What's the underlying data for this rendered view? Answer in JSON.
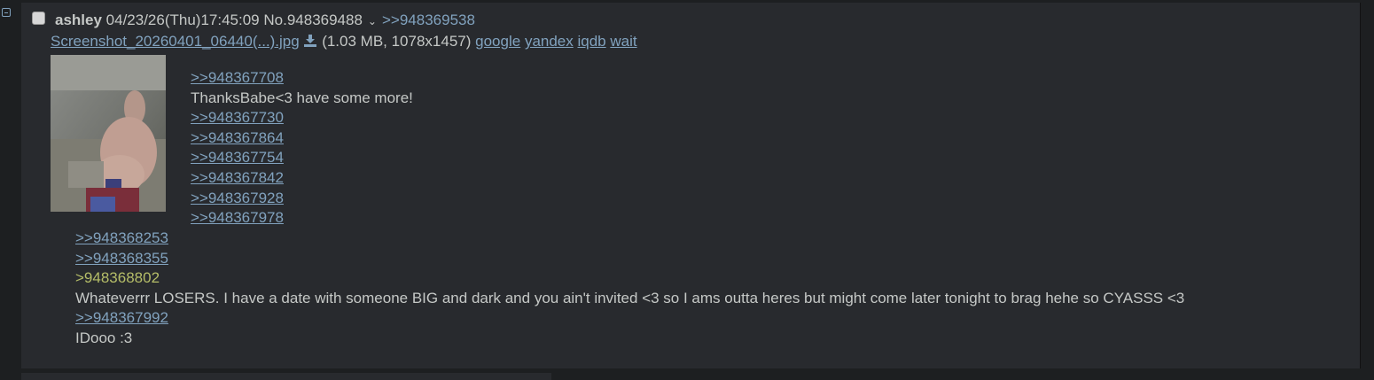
{
  "post": {
    "name": "ashley",
    "datetime": "04/23/26(Thu)17:45:09",
    "number": "No.948369488",
    "backlinks": [
      ">>948369538"
    ],
    "file": {
      "name": "Screenshot_20260401_06440(...).jpg",
      "meta": "(1.03 MB, 1078x1457)",
      "search_links": [
        "google",
        "yandex",
        "iqdb",
        "wait"
      ]
    },
    "lines_beside_image": [
      ">>948367708",
      "ThanksBabe<3 have some more!",
      ">>948367730",
      ">>948367864",
      ">>948367754",
      ">>948367842",
      ">>948367928",
      ">>948367978"
    ],
    "lines_below_image": [
      ">>948368253",
      ">>948368355",
      ">948368802",
      "Whateverrr LOSERS. I have a date with someone BIG and dark and you ain't invited <3 so I ams outta heres but might come later tonight to brag hehe so CYASSS <3",
      ">>948367992",
      "IDooo :3"
    ]
  },
  "colors": {
    "background": "#1d1f21",
    "post_background": "#282a2e",
    "text": "#c5c8c6",
    "link": "#81a2be",
    "greentext": "#b5bd68"
  },
  "icons": {
    "hide": "minus-box-icon",
    "download": "download-icon",
    "menu": "chevron-down-icon"
  }
}
